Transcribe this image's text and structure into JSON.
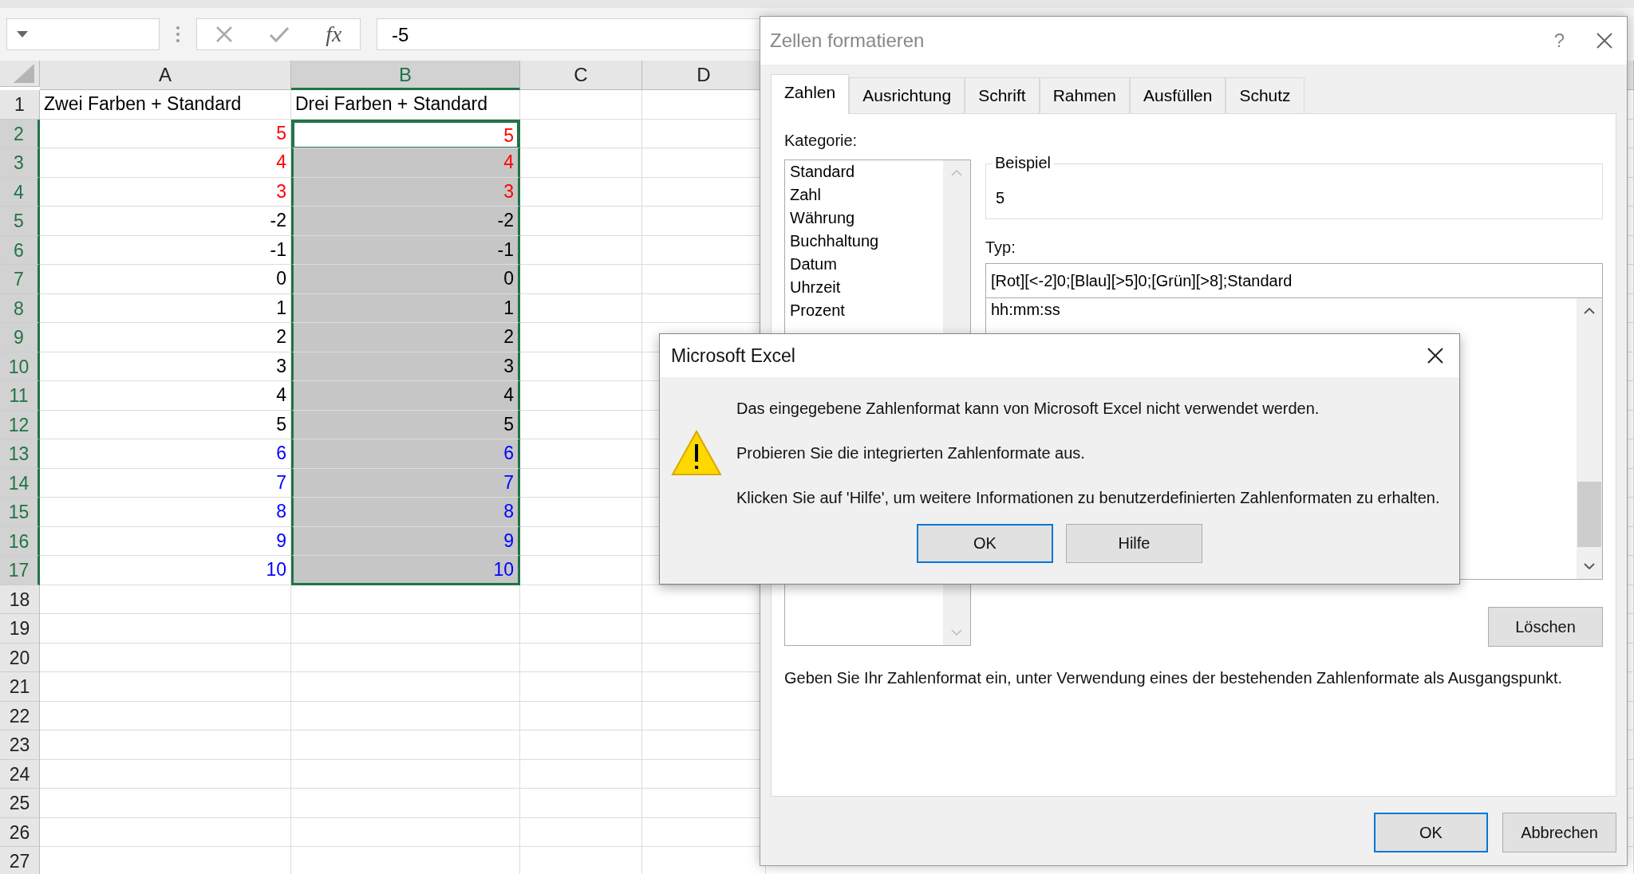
{
  "formula_bar": {
    "function_label": "fx",
    "value": "-5"
  },
  "columns": [
    {
      "label": "A",
      "selected": false
    },
    {
      "label": "B",
      "selected": true
    },
    {
      "label": "C",
      "selected": false
    },
    {
      "label": "D",
      "selected": false
    }
  ],
  "rows": [
    {
      "number": "1",
      "kind": "text",
      "a": "Zwei Farben + Standard",
      "b": "Drei Farben + Standard",
      "color": "#000000",
      "selected": false,
      "active": false
    },
    {
      "number": "2",
      "kind": "number",
      "a": "5",
      "b": "5",
      "color": "#ff0000",
      "selected": true,
      "active": true
    },
    {
      "number": "3",
      "kind": "number",
      "a": "4",
      "b": "4",
      "color": "#ff0000",
      "selected": true,
      "active": false
    },
    {
      "number": "4",
      "kind": "number",
      "a": "3",
      "b": "3",
      "color": "#ff0000",
      "selected": true,
      "active": false
    },
    {
      "number": "5",
      "kind": "number",
      "a": "-2",
      "b": "-2",
      "color": "#000000",
      "selected": true,
      "active": false
    },
    {
      "number": "6",
      "kind": "number",
      "a": "-1",
      "b": "-1",
      "color": "#000000",
      "selected": true,
      "active": false
    },
    {
      "number": "7",
      "kind": "number",
      "a": "0",
      "b": "0",
      "color": "#000000",
      "selected": true,
      "active": false
    },
    {
      "number": "8",
      "kind": "number",
      "a": "1",
      "b": "1",
      "color": "#000000",
      "selected": true,
      "active": false
    },
    {
      "number": "9",
      "kind": "number",
      "a": "2",
      "b": "2",
      "color": "#000000",
      "selected": true,
      "active": false
    },
    {
      "number": "10",
      "kind": "number",
      "a": "3",
      "b": "3",
      "color": "#000000",
      "selected": true,
      "active": false
    },
    {
      "number": "11",
      "kind": "number",
      "a": "4",
      "b": "4",
      "color": "#000000",
      "selected": true,
      "active": false
    },
    {
      "number": "12",
      "kind": "number",
      "a": "5",
      "b": "5",
      "color": "#000000",
      "selected": true,
      "active": false
    },
    {
      "number": "13",
      "kind": "number",
      "a": "6",
      "b": "6",
      "color": "#0000ff",
      "selected": true,
      "active": false
    },
    {
      "number": "14",
      "kind": "number",
      "a": "7",
      "b": "7",
      "color": "#0000ff",
      "selected": true,
      "active": false
    },
    {
      "number": "15",
      "kind": "number",
      "a": "8",
      "b": "8",
      "color": "#0000ff",
      "selected": true,
      "active": false
    },
    {
      "number": "16",
      "kind": "number",
      "a": "9",
      "b": "9",
      "color": "#0000ff",
      "selected": true,
      "active": false
    },
    {
      "number": "17",
      "kind": "number",
      "a": "10",
      "b": "10",
      "color": "#0000ff",
      "selected": true,
      "active": false
    },
    {
      "number": "18",
      "kind": "empty",
      "selected": false,
      "active": false
    },
    {
      "number": "19",
      "kind": "empty",
      "selected": false,
      "active": false
    },
    {
      "number": "20",
      "kind": "empty",
      "selected": false,
      "active": false
    },
    {
      "number": "21",
      "kind": "empty",
      "selected": false,
      "active": false
    },
    {
      "number": "22",
      "kind": "empty",
      "selected": false,
      "active": false
    },
    {
      "number": "23",
      "kind": "empty",
      "selected": false,
      "active": false
    },
    {
      "number": "24",
      "kind": "empty",
      "selected": false,
      "active": false
    },
    {
      "number": "25",
      "kind": "empty",
      "selected": false,
      "active": false
    },
    {
      "number": "26",
      "kind": "empty",
      "selected": false,
      "active": false
    },
    {
      "number": "27",
      "kind": "empty",
      "selected": false,
      "active": false
    }
  ],
  "format_dialog": {
    "title": "Zellen formatieren",
    "help": "?",
    "tabs": [
      {
        "label": "Zahlen",
        "selected": true
      },
      {
        "label": "Ausrichtung",
        "selected": false
      },
      {
        "label": "Schrift",
        "selected": false
      },
      {
        "label": "Rahmen",
        "selected": false
      },
      {
        "label": "Ausfüllen",
        "selected": false
      },
      {
        "label": "Schutz",
        "selected": false
      }
    ],
    "category_label": "Kategorie:",
    "categories": [
      "Standard",
      "Zahl",
      "Währung",
      "Buchhaltung",
      "Datum",
      "Uhrzeit",
      "Prozent"
    ],
    "sample_label": "Beispiel",
    "sample_value": "5",
    "type_label": "Typ:",
    "type_value": "[Rot][<-2]0;[Blau][>5]0;[Grün][>8];Standard",
    "type_list": [
      "hh:mm:ss"
    ],
    "delete_button": "Löschen",
    "hint": "Geben Sie Ihr Zahlenformat ein, unter Verwendung eines der bestehenden Zahlenformate als Ausgangspunkt.",
    "buttons": [
      {
        "label": "OK",
        "default": true
      },
      {
        "label": "Abbrechen",
        "default": false
      }
    ]
  },
  "message_box": {
    "title": "Microsoft Excel",
    "paragraphs": [
      "Das eingegebene Zahlenformat kann von Microsoft Excel nicht verwendet werden.",
      "Probieren Sie die integrierten Zahlenformate aus.",
      "Klicken Sie auf 'Hilfe', um weitere Informationen zu benutzerdefinierten Zahlenformaten zu erhalten."
    ],
    "buttons": [
      {
        "label": "OK",
        "default": true
      },
      {
        "label": "Hilfe",
        "default": false
      }
    ]
  }
}
